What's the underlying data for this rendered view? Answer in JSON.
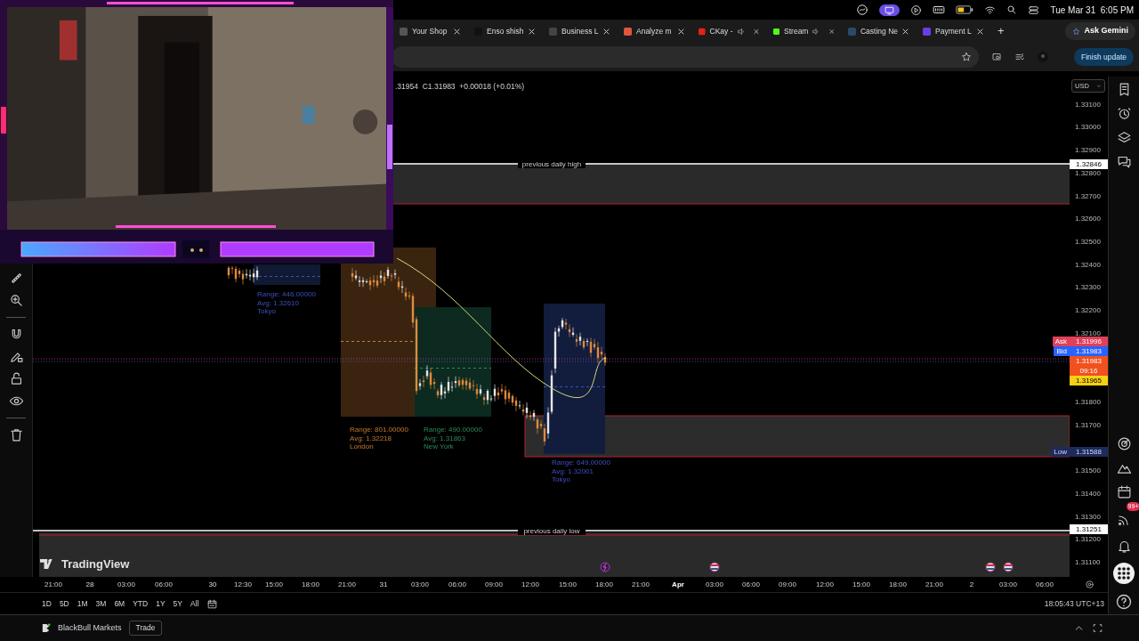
{
  "menu_bar": {
    "clock": "Tue Mar 31  6:05 PM"
  },
  "browser": {
    "tabs": [
      {
        "label": "Your Shop",
        "audio": false
      },
      {
        "label": "Enso shish",
        "audio": false
      },
      {
        "label": "Business L",
        "audio": false
      },
      {
        "label": "Analyze m",
        "audio": false
      },
      {
        "label": "CKay -",
        "audio": true
      },
      {
        "label": "Stream",
        "audio": true
      },
      {
        "label": "Casting Ne",
        "audio": false
      },
      {
        "label": "Payment L",
        "audio": false
      }
    ],
    "new_tab": "+",
    "ask_button": "Ask Gemini",
    "update_button": "Finish update"
  },
  "chart": {
    "ohlc": ".31954  C1.31983  +0.00018 (+0.01%)",
    "currency": "USD",
    "logo": "TradingView",
    "price_ticks": [
      "1.33100",
      "1.33000",
      "1.32900",
      "1.32800",
      "1.32700",
      "1.32600",
      "1.32500",
      "1.32400",
      "1.32300",
      "1.32200",
      "1.32100",
      "1.31800",
      "1.31700",
      "1.31500",
      "1.31400",
      "1.31300",
      "1.31200",
      "1.31100"
    ],
    "price_tags": [
      {
        "kind": "line",
        "value": "1.32846"
      },
      {
        "kind": "ask",
        "label": "Ask",
        "value": "1.31996"
      },
      {
        "kind": "bid",
        "label": "Bid",
        "value": "1.31983"
      },
      {
        "kind": "last",
        "value": "1.31983",
        "countdown": "09:16"
      },
      {
        "kind": "ema",
        "value": "1.31965"
      },
      {
        "kind": "low",
        "label": "Low",
        "value": "1.31588"
      },
      {
        "kind": "line",
        "value": "1.31251"
      }
    ],
    "levels": [
      {
        "label": "previous daily high"
      },
      {
        "label": "previous daily low"
      }
    ],
    "sessions": [
      {
        "range": "Range: 446.00000",
        "avg": "Avg: 1.32610",
        "name": "Tokyo"
      },
      {
        "range": "Range: 801.00000",
        "avg": "Avg: 1.32218",
        "name": "London"
      },
      {
        "range": "Range: 490.00000",
        "avg": "Avg: 1.31863",
        "name": "New York"
      },
      {
        "range": "Range: 649.00000",
        "avg": "Avg: 1.32001",
        "name": "Tokyo"
      }
    ],
    "time_ticks": [
      {
        "label": "21:00",
        "kind": "time"
      },
      {
        "label": "28",
        "kind": "day"
      },
      {
        "label": "03:00",
        "kind": "time"
      },
      {
        "label": "06:00",
        "kind": "time"
      },
      {
        "label": "30",
        "kind": "day"
      },
      {
        "label": "12:30",
        "kind": "time"
      },
      {
        "label": "15:00",
        "kind": "time"
      },
      {
        "label": "18:00",
        "kind": "time"
      },
      {
        "label": "21:00",
        "kind": "time"
      },
      {
        "label": "31",
        "kind": "day"
      },
      {
        "label": "03:00",
        "kind": "time"
      },
      {
        "label": "06:00",
        "kind": "time"
      },
      {
        "label": "09:00",
        "kind": "time"
      },
      {
        "label": "12:00",
        "kind": "time"
      },
      {
        "label": "15:00",
        "kind": "time"
      },
      {
        "label": "18:00",
        "kind": "time"
      },
      {
        "label": "21:00",
        "kind": "time"
      },
      {
        "label": "Apr",
        "kind": "month"
      },
      {
        "label": "03:00",
        "kind": "time"
      },
      {
        "label": "06:00",
        "kind": "time"
      },
      {
        "label": "09:00",
        "kind": "time"
      },
      {
        "label": "12:00",
        "kind": "time"
      },
      {
        "label": "15:00",
        "kind": "time"
      },
      {
        "label": "18:00",
        "kind": "time"
      },
      {
        "label": "21:00",
        "kind": "time"
      },
      {
        "label": "2",
        "kind": "day"
      },
      {
        "label": "03:00",
        "kind": "time"
      },
      {
        "label": "06:00",
        "kind": "time"
      }
    ],
    "ranges": [
      "1D",
      "5D",
      "1M",
      "3M",
      "6M",
      "YTD",
      "1Y",
      "5Y",
      "All"
    ],
    "clock": "18:05:43 UTC+13"
  },
  "sidebar": {
    "alerts_badge": "99+"
  },
  "bottom_bar": {
    "broker": "BlackBull Markets",
    "trade_button": "Trade"
  }
}
